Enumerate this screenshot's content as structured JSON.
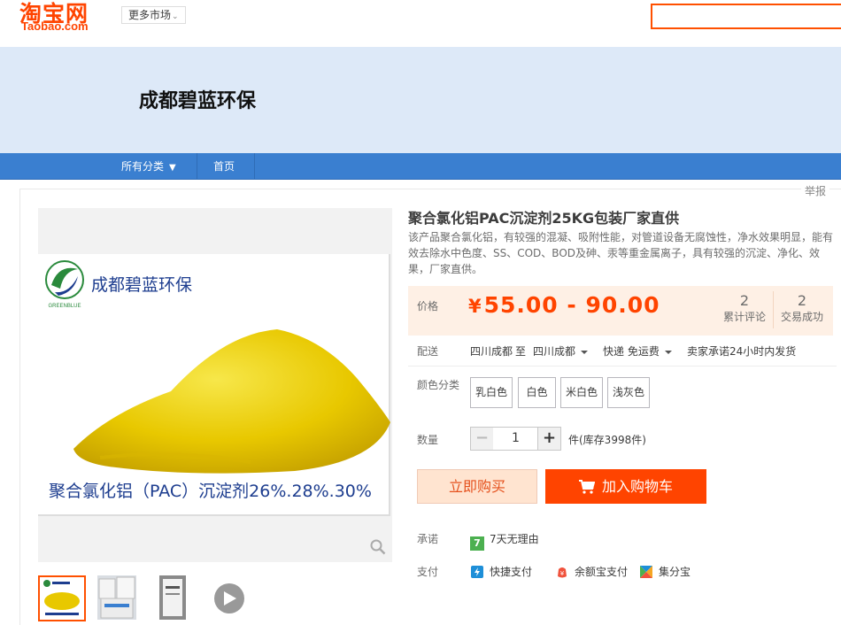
{
  "header": {
    "logo_cn": "淘宝网",
    "logo_en": "Taobao.com",
    "more_markets": "更多市场",
    "search_placeholder": ""
  },
  "shop": {
    "name": "成都碧蓝环保",
    "nav": {
      "all_categories": "所有分类",
      "home": "首页"
    }
  },
  "report_link": "举报",
  "gallery": {
    "brand_name": "成都碧蓝环保",
    "brand_logo_text": "GREENBLUE",
    "caption": "聚合氯化铝（PAC）沉淀剂26%.28%.30%"
  },
  "product": {
    "title": "聚合氯化铝PAC沉淀剂25KG包装厂家直供",
    "description": "该产品聚合氯化铝，有较强的混凝、吸附性能，对管道设备无腐蚀性，净水效果明显，能有效去除水中色度、SS、COD、BOD及砷、汞等重金属离子，具有较强的沉淀、净化、效果，厂家直供。",
    "price_label": "价格",
    "currency": "¥",
    "price": "55.00 - 90.00",
    "stats": [
      {
        "value": "2",
        "label": "累计评论"
      },
      {
        "value": "2",
        "label": "交易成功"
      }
    ],
    "delivery": {
      "label": "配送",
      "from": "四川成都",
      "to_word": "至",
      "to": "四川成都",
      "shipping": "快递 免运费",
      "promise": "卖家承诺24小时内发货"
    },
    "color": {
      "label": "颜色分类",
      "options": [
        "乳白色",
        "白色",
        "米白色",
        "浅灰色"
      ]
    },
    "quantity": {
      "label": "数量",
      "value": "1",
      "minus": "−",
      "plus": "+",
      "stock": "件(库存3998件)"
    },
    "buttons": {
      "buy_now": "立即购买",
      "add_to_cart": "加入购物车"
    },
    "service": {
      "label": "承诺",
      "item": "7天无理由",
      "badge": "7"
    },
    "payment": {
      "label": "支付",
      "methods": [
        "快捷支付",
        "余额宝支付",
        "集分宝"
      ]
    }
  },
  "colors": {
    "accent": "#ff4400",
    "nav": "#3a7fd0",
    "banner": "#dde9f8",
    "price_bg": "#fef0e5"
  }
}
